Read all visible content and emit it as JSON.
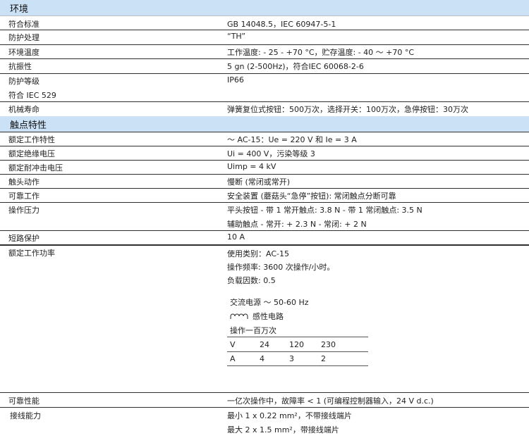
{
  "sections": {
    "environment": "环境",
    "contact": "触点特性"
  },
  "env": {
    "standard": {
      "label": "符合标准",
      "value": "GB 14048.5，IEC 60947-5-1"
    },
    "protection_treatment": {
      "label": "防护处理",
      "value": "“TH”"
    },
    "ambient_temp": {
      "label": "环境温度",
      "value": "工作温度: - 25 - +70 °C，贮存温度: - 40 ～ +70 °C"
    },
    "vibration": {
      "label": "抗振性",
      "value": "5 gn (2-500Hz)，符合IEC 60068-2-6"
    },
    "ip_rating": {
      "label": "防护等级",
      "label2": "符合 IEC 529",
      "value": "IP66"
    },
    "mech_life": {
      "label": "机械寿命",
      "value": "弹簧复位式按钮：500万次，选择开关：100万次，急停按钮：30万次"
    }
  },
  "contact": {
    "rated_char": {
      "label": "额定工作特性",
      "value": "～ AC-15：Ue = 220 V 和 Ie = 3 A"
    },
    "insulation": {
      "label": "额定绝缘电压",
      "value": "Ui = 400 V，污染等级 3"
    },
    "impulse": {
      "label": "额定耐冲击电压",
      "value": "Uimp = 4 kV"
    },
    "action": {
      "label": "触头动作",
      "value": "慢断 (常闭或常开)"
    },
    "reliable": {
      "label": "可靠工作",
      "value": "安全装置 (蘑菇头“急停”按钮): 常闭触点分断可靠"
    },
    "force": {
      "label": "操作压力",
      "value1": "平头按钮 - 带 1 常开触点: 3.8 N - 带 1 常闭触点: 3.5 N",
      "value2": "辅助触点 - 常开: + 2.3 N - 常闭: + 2 N"
    },
    "short_circuit": {
      "label": "短路保护",
      "value": "10 A"
    },
    "power": {
      "label": "额定工作功率",
      "usage": "使用类别：AC-15",
      "frequency": "操作频率: 3600 次操作/小时。",
      "load_factor": "负载因数: 0.5",
      "ac_supply": "交流电源 ～ 50-60 Hz",
      "inductive": "感性电路",
      "million_ops": "操作一百万次",
      "table": {
        "header": [
          "V",
          "24",
          "120",
          "230"
        ],
        "row": [
          "A",
          "4",
          "3",
          "2"
        ]
      }
    },
    "reliability": {
      "label": "可靠性能",
      "value": "一亿次操作中，故障率 < 1 (可编程控制器输入，24 V d.c.)"
    },
    "connection": {
      "label": "接线能力",
      "value1": "最小 1 x 0.22 mm²，不带接线端片",
      "value2": "最大 2 x 1.5 mm²，带接线端片"
    }
  }
}
